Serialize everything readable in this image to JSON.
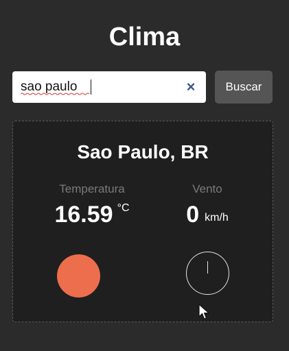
{
  "app": {
    "title": "Clima"
  },
  "search": {
    "value": "sao paulo",
    "clear_icon": "close-icon",
    "clear_label": "×",
    "button_label": "Buscar"
  },
  "weather": {
    "city": "Sao Paulo, BR",
    "temperature_label": "Temperatura",
    "temperature_value": "16.59",
    "temperature_unit": "°C",
    "temperature_color": "#ec6e4c",
    "wind_label": "Vento",
    "wind_value": "0",
    "wind_unit": "km/h",
    "wind_icon": "compass-icon"
  },
  "colors": {
    "background": "#2b2b2b",
    "card": "#1f1f1f",
    "button": "#555555"
  }
}
